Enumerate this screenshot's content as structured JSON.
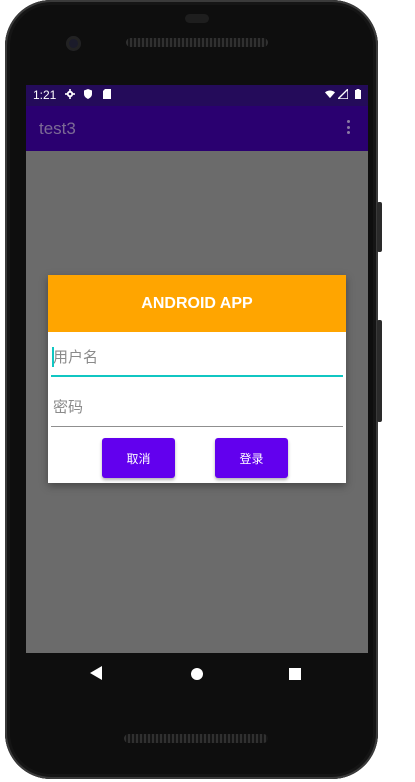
{
  "status_bar": {
    "time": "1:21",
    "icons": [
      "gear-icon",
      "shield-icon",
      "sd-card-icon",
      "wifi-icon",
      "signal-icon",
      "battery-icon"
    ]
  },
  "app_bar": {
    "title": "test3",
    "menu_icon": "overflow-menu-icon"
  },
  "dialog": {
    "title": "ANDROID APP",
    "username_placeholder": "用户名",
    "password_placeholder": "密码",
    "cancel_label": "取消",
    "login_label": "登录"
  },
  "nav_bar": {
    "icons": [
      "back-icon",
      "home-icon",
      "recents-icon"
    ]
  },
  "colors": {
    "status_bar": "#240b5a",
    "app_bar": "#2a0070",
    "dialog_header": "#ffa500",
    "button": "#6200ee",
    "focus_underline": "#10c6c2",
    "scrim": "#6b6b6b"
  }
}
